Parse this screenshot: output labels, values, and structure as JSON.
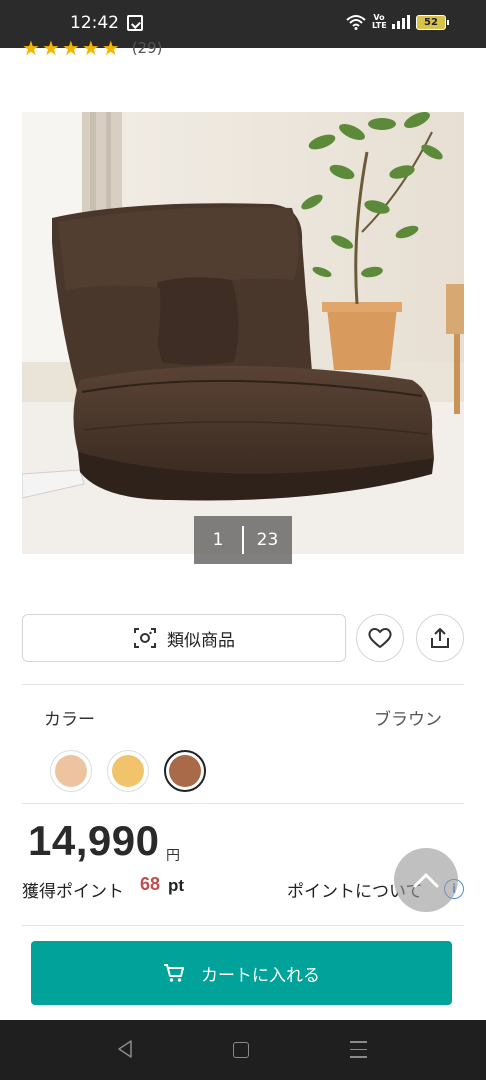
{
  "status_bar": {
    "time": "12:42",
    "network_label": "Vo LTE",
    "battery_level": "52"
  },
  "rating": {
    "stars": 5,
    "count_text": "(29)"
  },
  "gallery": {
    "current": "1",
    "total": "23"
  },
  "actions": {
    "similar_label": "類似商品"
  },
  "color": {
    "label": "カラー",
    "selected_value": "ブラウン",
    "swatches": [
      "#eec3a0",
      "#f1c36a",
      "#a86a48"
    ],
    "selected_index": 2
  },
  "price": {
    "value": "14,990",
    "unit": "円"
  },
  "points": {
    "label": "獲得ポイント",
    "value": "68",
    "unit": "pt",
    "about_link": "ポイントについて"
  },
  "cart": {
    "label": "カートに入れる"
  },
  "colors": {
    "accent": "#00a29a",
    "points_value": "#c0504d",
    "star": "#f2b600"
  }
}
